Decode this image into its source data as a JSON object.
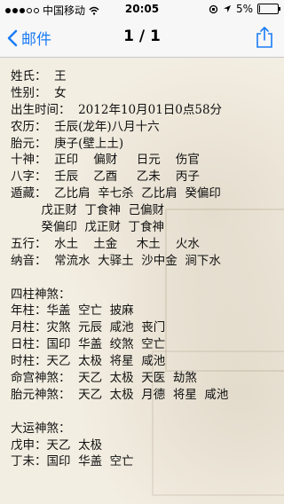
{
  "status": {
    "carrier": "中国移动",
    "wifi": "wifi-icon",
    "time": "20:05",
    "battery": "5%",
    "battery_level": 0.05
  },
  "nav": {
    "back_label": "邮件",
    "title": "1 / 1"
  },
  "doc": {
    "lines": [
      "姓氏：  王",
      "性别：  女",
      "出生时间：  2012年10月01日0点58分",
      "农历：  壬辰(龙年)八月十六",
      "胎元：  庚子(壁上土)",
      "十神：  正印    偏财     日元    伤官",
      "八字：  壬辰    乙酉     乙未    丙子",
      "遁藏：  乙比肩  辛七杀  乙比肩  癸偏印",
      "        戊正财  丁食神  己偏财",
      "        癸偏印  戊正财  丁食神",
      "五行：  水土    土金     木土    火水",
      "纳音：  常流水  大驿土  沙中金  涧下水",
      "",
      "四柱神煞：",
      "年柱：华盖  空亡  披麻",
      "月柱：灾煞  元辰  咸池  丧门",
      "日柱：国印  华盖  绞煞  空亡",
      "时柱：天乙  太极  将星  咸池",
      "命宫神煞：  天乙  太极  天医  劫煞",
      "胎元神煞：  天乙  太极  月德  将星  咸池",
      "",
      "大运神煞：",
      "戊申：天乙  太极",
      "丁未：国印  华盖  空亡"
    ]
  }
}
